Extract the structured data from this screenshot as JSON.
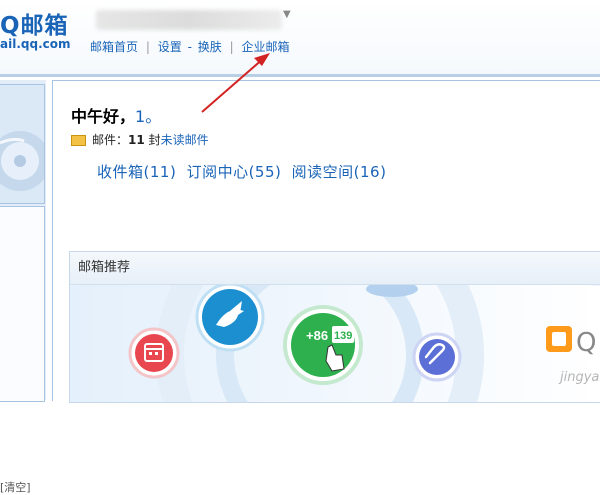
{
  "header": {
    "logo_name": "Q邮箱",
    "logo_url": "ail.qq.com",
    "toplinks": {
      "home": "邮箱首页",
      "settings": "设置",
      "dash": "-",
      "skin": "换肤",
      "enterprise": "企业邮箱",
      "separator": "|"
    },
    "user_caret": "▼"
  },
  "sidebar": {
    "clear_label": "[清空]"
  },
  "main": {
    "greeting": "中午好，",
    "username": "1。",
    "mail_prefix": "邮件：",
    "mail_count": "11",
    "mail_unit": "封",
    "mail_unread": "未读邮件",
    "folders": {
      "inbox": "收件箱(11)",
      "subscribe": "订阅中心(55)",
      "reading": "阅读空间(16)"
    }
  },
  "recommend": {
    "title": "邮箱推荐",
    "phone_prefix": "+86",
    "phone_digits": "139",
    "qq_text": "Q",
    "watermark": "jingyan"
  },
  "colors": {
    "brand_blue": "#1a64b8",
    "green_circle": "#2db04d",
    "teal_circle": "#1c8fd1",
    "red_circle": "#e8474f",
    "purple_circle": "#5b6fd6",
    "arrow_red": "#d32222"
  }
}
